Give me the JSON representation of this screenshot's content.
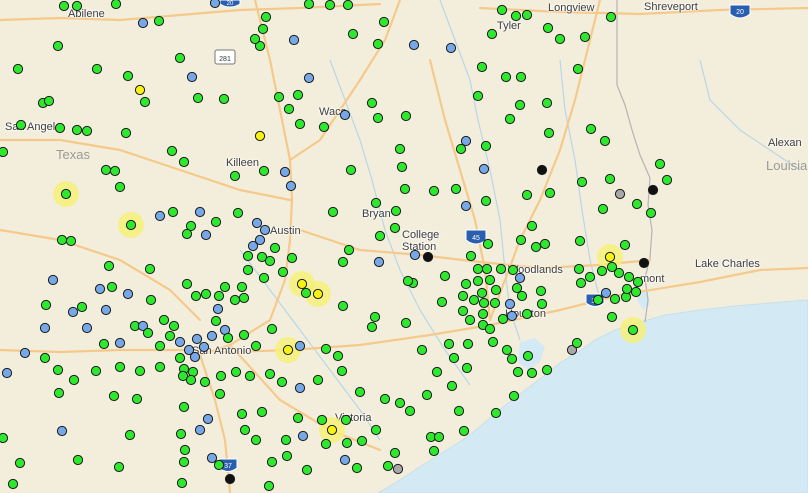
{
  "map": {
    "cities": [
      {
        "id": "abilene",
        "label": "Abilene"
      },
      {
        "id": "longview",
        "label": "Longview"
      },
      {
        "id": "shreveport",
        "label": "Shreveport"
      },
      {
        "id": "tyler",
        "label": "Tyler"
      },
      {
        "id": "san-angelo",
        "label": "San Angelo"
      },
      {
        "id": "waco",
        "label": "Waco"
      },
      {
        "id": "killeen",
        "label": "Killeen"
      },
      {
        "id": "bryan",
        "label": "Bryan"
      },
      {
        "id": "college-station",
        "label": "College\nStation"
      },
      {
        "id": "austin",
        "label": "Austin"
      },
      {
        "id": "woodlands",
        "label": "Woodlands"
      },
      {
        "id": "houston",
        "label": "Houston"
      },
      {
        "id": "beaumont",
        "label": "mont"
      },
      {
        "id": "lake-charles",
        "label": "Lake Charles"
      },
      {
        "id": "alexandria",
        "label": "Alexan"
      },
      {
        "id": "san-antonio",
        "label": "San Antonio"
      },
      {
        "id": "victoria",
        "label": "Victoria"
      }
    ],
    "states": [
      {
        "id": "texas",
        "label": "Texas"
      },
      {
        "id": "louisiana",
        "label": "Louisia"
      }
    ],
    "shields": [
      {
        "id": "i20-east",
        "label": "20"
      },
      {
        "id": "i20-top",
        "label": "20"
      },
      {
        "id": "us281",
        "label": "281"
      },
      {
        "id": "i45",
        "label": "45"
      },
      {
        "id": "i10",
        "label": "10"
      },
      {
        "id": "i37",
        "label": "37"
      }
    ],
    "colors": {
      "land": "#f3eedc",
      "water": "#d3eaf5",
      "road": "#f5c98a",
      "border": "#b3b3b3",
      "status_green": "#2ee82e",
      "status_blue": "#76a8e8",
      "status_yellow": "#f5f214",
      "status_black": "#111111",
      "status_gray": "#a8a8a8",
      "highlight_halo": "#f4f078"
    }
  }
}
